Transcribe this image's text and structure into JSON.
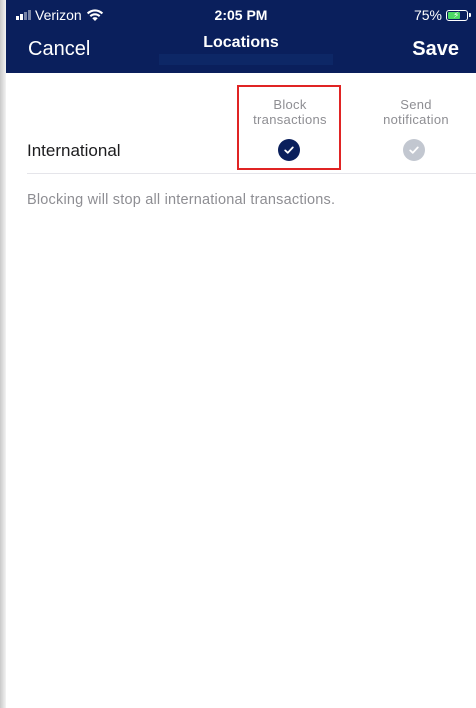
{
  "status_bar": {
    "carrier": "Verizon",
    "time": "2:05 PM",
    "battery_percent": "75%",
    "battery_level": 0.75,
    "signal_icon": "signal-bars-icon",
    "wifi_icon": "wifi-icon",
    "battery_icon": "battery-charging-icon"
  },
  "nav": {
    "cancel_label": "Cancel",
    "title": "Locations",
    "save_label": "Save"
  },
  "columns": {
    "block_line1": "Block",
    "block_line2": "transactions",
    "notify_line1": "Send",
    "notify_line2": "notification"
  },
  "rows": [
    {
      "label": "International",
      "block_checked": true,
      "notify_checked": true
    }
  ],
  "footnote": "Blocking will stop all international transactions.",
  "colors": {
    "header_bg": "#0a1f5c",
    "check_active": "#0a1f5c",
    "check_inactive": "#c2c7d0",
    "highlight": "#e02424"
  }
}
